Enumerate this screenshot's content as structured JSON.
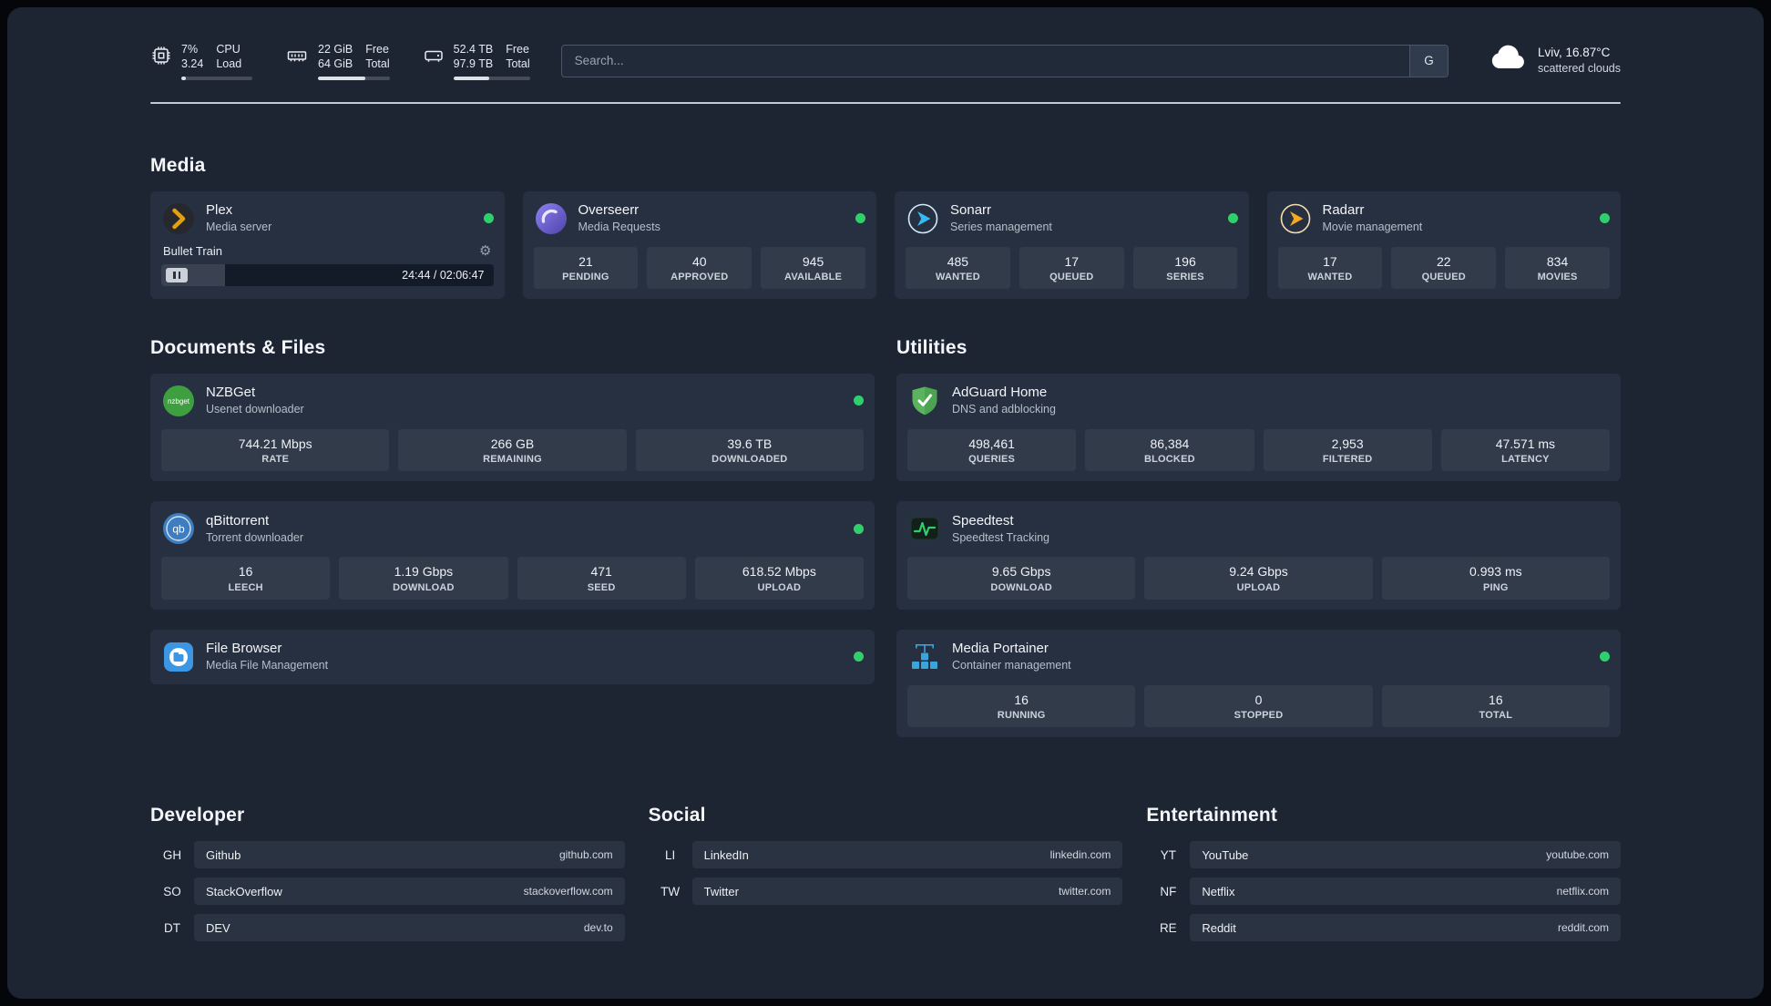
{
  "header": {
    "cpu": {
      "value_top": "7%",
      "value_bottom": "3.24",
      "label_top": "CPU",
      "label_bottom": "Load"
    },
    "memory": {
      "value_top": "22 GiB",
      "value_bottom": "64 GiB",
      "label_top": "Free",
      "label_bottom": "Total"
    },
    "disk": {
      "value_top": "52.4 TB",
      "value_bottom": "97.9 TB",
      "label_top": "Free",
      "label_bottom": "Total"
    },
    "search": {
      "placeholder": "Search...",
      "provider": "G"
    },
    "weather": {
      "location": "Lviv, 16.87°C",
      "condition": "scattered clouds"
    }
  },
  "icons": {
    "gear": "⚙"
  },
  "colors": {
    "background": "#1d2533",
    "card": "#273040",
    "status_ok": "#2fd06b",
    "plex_accent": "#e5a00d"
  },
  "sections": {
    "media": {
      "title": "Media",
      "cards": [
        {
          "title": "Plex",
          "subtitle": "Media server",
          "player": {
            "track": "Bullet Train",
            "time": "24:44 / 02:06:47"
          }
        },
        {
          "title": "Overseerr",
          "subtitle": "Media Requests",
          "stats": [
            {
              "value": "21",
              "label": "PENDING"
            },
            {
              "value": "40",
              "label": "APPROVED"
            },
            {
              "value": "945",
              "label": "AVAILABLE"
            }
          ]
        },
        {
          "title": "Sonarr",
          "subtitle": "Series management",
          "stats": [
            {
              "value": "485",
              "label": "WANTED"
            },
            {
              "value": "17",
              "label": "QUEUED"
            },
            {
              "value": "196",
              "label": "SERIES"
            }
          ]
        },
        {
          "title": "Radarr",
          "subtitle": "Movie management",
          "stats": [
            {
              "value": "17",
              "label": "WANTED"
            },
            {
              "value": "22",
              "label": "QUEUED"
            },
            {
              "value": "834",
              "label": "MOVIES"
            }
          ]
        }
      ]
    },
    "files": {
      "title": "Documents & Files",
      "cards": [
        {
          "title": "NZBGet",
          "subtitle": "Usenet downloader",
          "stats": [
            {
              "value": "744.21 Mbps",
              "label": "RATE"
            },
            {
              "value": "266 GB",
              "label": "REMAINING"
            },
            {
              "value": "39.6 TB",
              "label": "DOWNLOADED"
            }
          ]
        },
        {
          "title": "qBittorrent",
          "subtitle": "Torrent downloader",
          "stats": [
            {
              "value": "16",
              "label": "LEECH"
            },
            {
              "value": "1.19 Gbps",
              "label": "DOWNLOAD"
            },
            {
              "value": "471",
              "label": "SEED"
            },
            {
              "value": "618.52 Mbps",
              "label": "UPLOAD"
            }
          ]
        },
        {
          "title": "File Browser",
          "subtitle": "Media File Management"
        }
      ]
    },
    "utilities": {
      "title": "Utilities",
      "cards": [
        {
          "title": "AdGuard Home",
          "subtitle": "DNS and adblocking",
          "stats": [
            {
              "value": "498,461",
              "label": "QUERIES"
            },
            {
              "value": "86,384",
              "label": "BLOCKED"
            },
            {
              "value": "2,953",
              "label": "FILTERED"
            },
            {
              "value": "47.571 ms",
              "label": "LATENCY"
            }
          ]
        },
        {
          "title": "Speedtest",
          "subtitle": "Speedtest Tracking",
          "stats": [
            {
              "value": "9.65 Gbps",
              "label": "DOWNLOAD"
            },
            {
              "value": "9.24 Gbps",
              "label": "UPLOAD"
            },
            {
              "value": "0.993 ms",
              "label": "PING"
            }
          ]
        },
        {
          "title": "Media Portainer",
          "subtitle": "Container management",
          "stats": [
            {
              "value": "16",
              "label": "RUNNING"
            },
            {
              "value": "0",
              "label": "STOPPED"
            },
            {
              "value": "16",
              "label": "TOTAL"
            }
          ]
        }
      ]
    }
  },
  "bookmarks": {
    "groups": [
      {
        "title": "Developer",
        "items": [
          {
            "abbr": "GH",
            "name": "Github",
            "url": "github.com"
          },
          {
            "abbr": "SO",
            "name": "StackOverflow",
            "url": "stackoverflow.com"
          },
          {
            "abbr": "DT",
            "name": "DEV",
            "url": "dev.to"
          }
        ]
      },
      {
        "title": "Social",
        "items": [
          {
            "abbr": "LI",
            "name": "LinkedIn",
            "url": "linkedin.com"
          },
          {
            "abbr": "TW",
            "name": "Twitter",
            "url": "twitter.com"
          }
        ]
      },
      {
        "title": "Entertainment",
        "items": [
          {
            "abbr": "YT",
            "name": "YouTube",
            "url": "youtube.com"
          },
          {
            "abbr": "NF",
            "name": "Netflix",
            "url": "netflix.com"
          },
          {
            "abbr": "RE",
            "name": "Reddit",
            "url": "reddit.com"
          }
        ]
      }
    ]
  }
}
